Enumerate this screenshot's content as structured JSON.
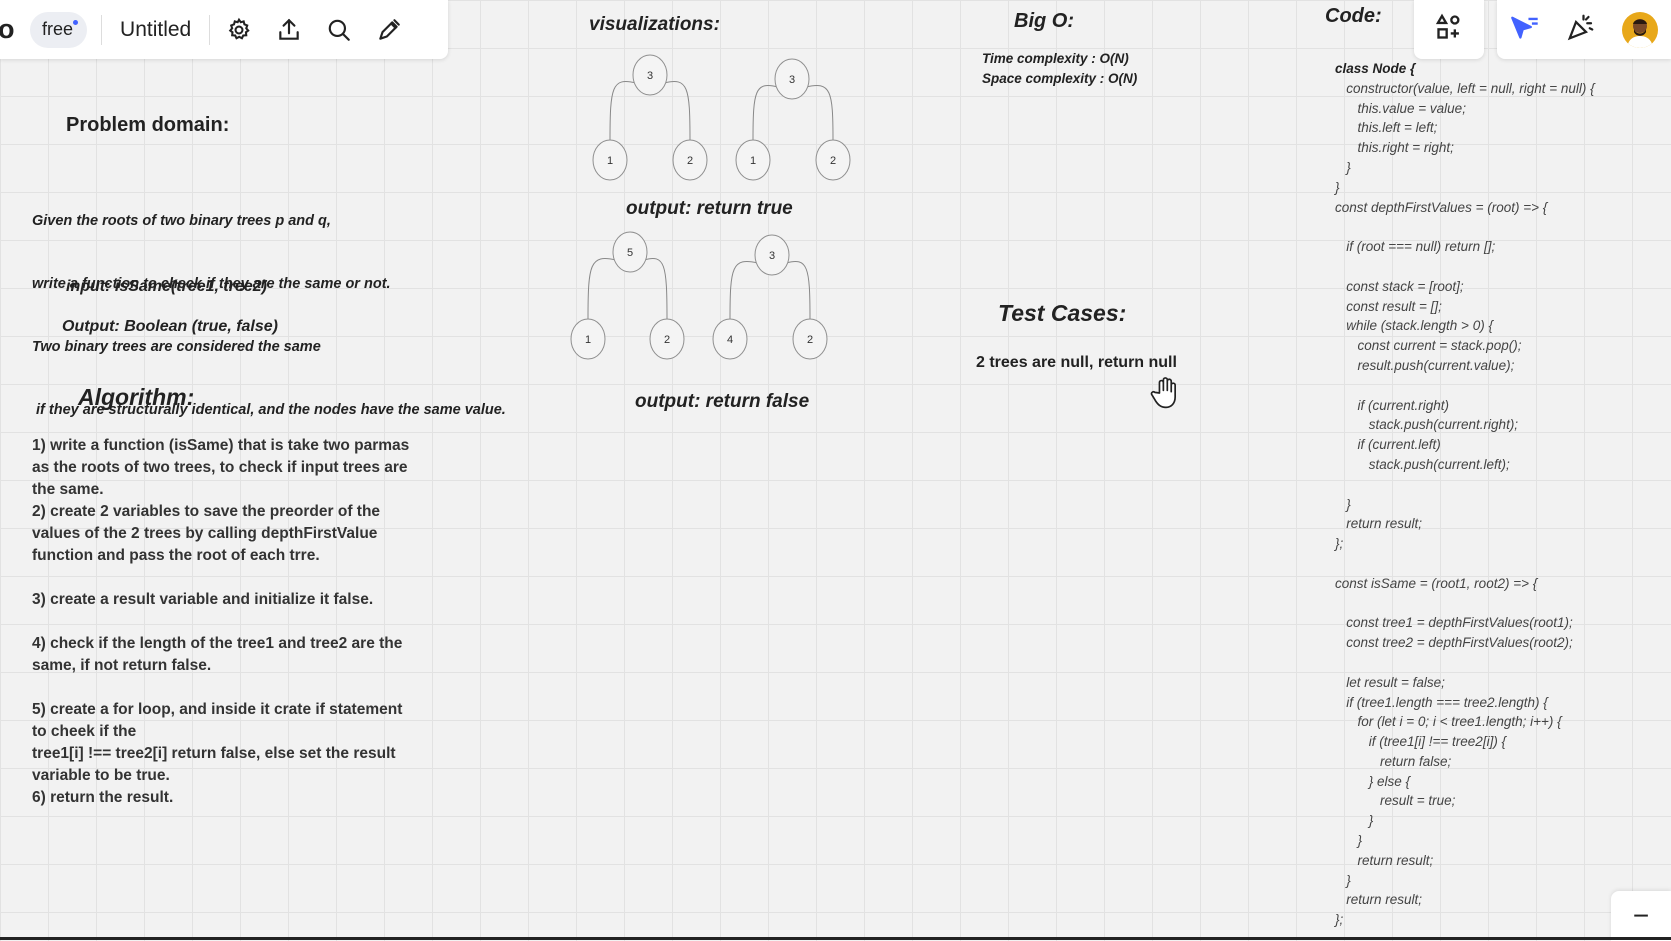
{
  "toolbar": {
    "logo_text": "o",
    "plan_label": "free",
    "doc_title": "Untitled"
  },
  "sections": {
    "problem_domain": {
      "heading": "Problem domain:",
      "lines": [
        "Given the roots of two binary trees p and q,",
        "write a function to check if they are the same or not.",
        "Two binary trees are considered the same",
        " if they are structurally identical, and the nodes have the same value."
      ],
      "input": "input: isSame(tree1, tree2)",
      "output": "Output: Boolean (true, false)"
    },
    "algorithm": {
      "heading": "Algorithm:",
      "lines": [
        "1) write a function (isSame) that is take two parmas",
        "as the roots of two trees, to check if input trees are",
        "the same.",
        "2) create 2 variables to save the preorder of the",
        "values of the 2 trees by calling depthFirstValue",
        "function and pass the root of each trre.",
        "",
        "3) create a result variable and initialize it false.",
        "",
        "4) check if the length of the tree1 and tree2 are the",
        "same, if not return false.",
        "",
        "5) create a for loop, and inside it crate if statement",
        "to cheek if the",
        "tree1[i] !== tree2[i] return false, else set the result",
        "variable to be true.",
        "6) return the result."
      ]
    },
    "visualizations": {
      "heading": "visualizations:",
      "output_true": "output: return true",
      "output_false": "output: return false",
      "trees": [
        {
          "root": "3",
          "left": "1",
          "right": "2"
        },
        {
          "root": "3",
          "left": "1",
          "right": "2"
        },
        {
          "root": "5",
          "left": "1",
          "right": "2"
        },
        {
          "root": "3",
          "left": "4",
          "right": "2"
        }
      ]
    },
    "big_o": {
      "heading": "Big O:",
      "time": "Time complexity : O(N)",
      "space": "Space complexity : O(N)"
    },
    "test_cases": {
      "heading": "Test Cases:",
      "case1": "2 trees are null, return null"
    },
    "code": {
      "heading": "Code:",
      "lines": [
        "class Node {",
        "   constructor(value, left = null, right = null) {",
        "      this.value = value;",
        "      this.left = left;",
        "      this.right = right;",
        "   }",
        "}",
        "const depthFirstValues = (root) => {",
        "",
        "   if (root === null) return [];",
        "",
        "   const stack = [root];",
        "   const result = [];",
        "   while (stack.length > 0) {",
        "      const current = stack.pop();",
        "      result.push(current.value);",
        "",
        "      if (current.right)",
        "         stack.push(current.right);",
        "      if (current.left)",
        "         stack.push(current.left);",
        "",
        "   }",
        "   return result;",
        "};",
        "",
        "const isSame = (root1, root2) => {",
        "",
        "   const tree1 = depthFirstValues(root1);",
        "   const tree2 = depthFirstValues(root2);",
        "",
        "   let result = false;",
        "   if (tree1.length === tree2.length) {",
        "      for (let i = 0; i < tree1.length; i++) {",
        "         if (tree1[i] !== tree2[i]) {",
        "            return false;",
        "         } else {",
        "            result = true;",
        "         }",
        "      }",
        "      return result;",
        "   }",
        "   return result;",
        "};"
      ]
    }
  },
  "zoom": {
    "minus_label": "−"
  }
}
